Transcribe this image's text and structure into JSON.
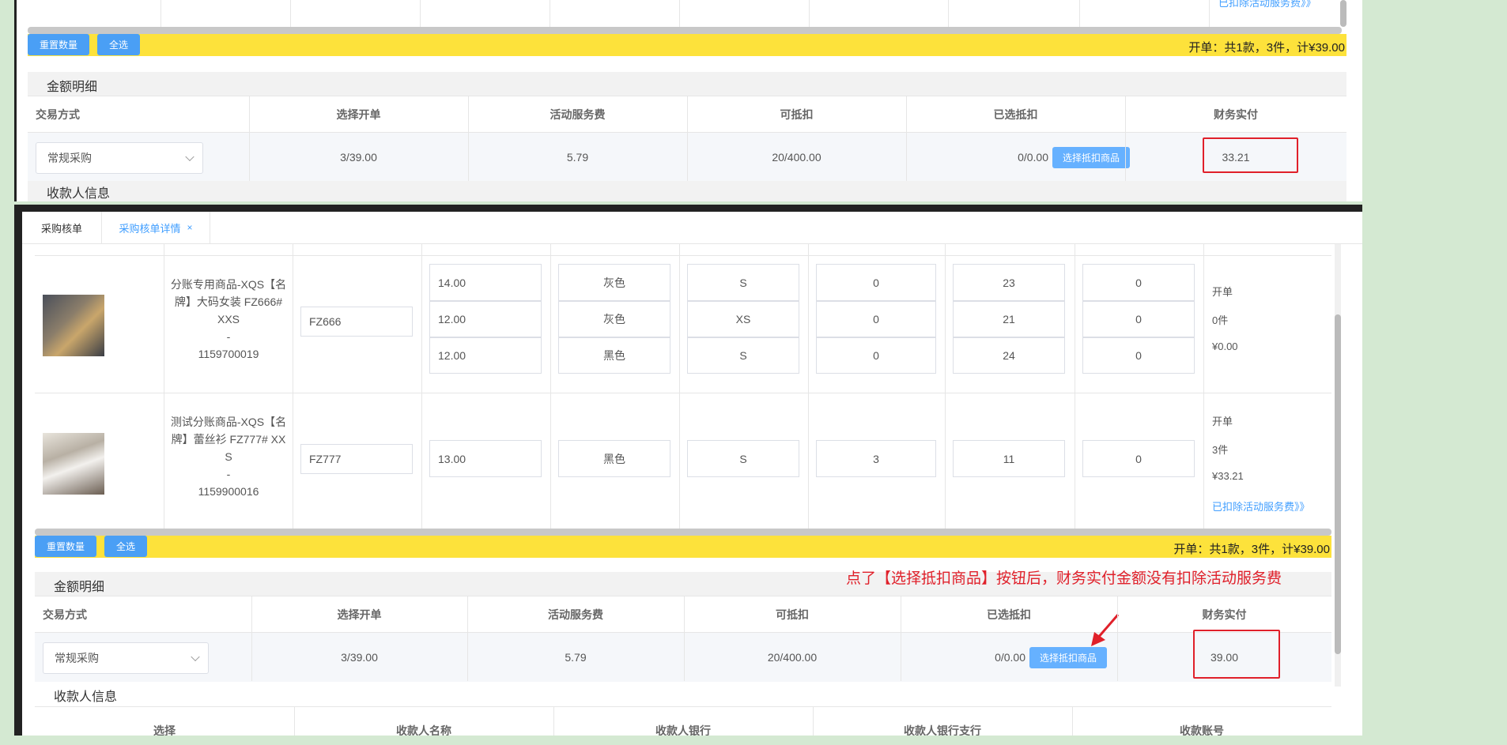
{
  "top": {
    "partial_link": "已扣除活动服务费》》",
    "reset_button": "重置数量",
    "select_all_button": "全选",
    "summary": "开单：共1款，3件，计¥39.00",
    "section_title": "金额明细",
    "headers": [
      "交易方式",
      "选择开单",
      "活动服务费",
      "可抵扣",
      "已选抵扣",
      "财务实付"
    ],
    "row": {
      "method": "常规采购",
      "order": "3/39.00",
      "fee": "5.79",
      "deductible": "20/400.00",
      "selected": "0/0.00",
      "deduct_button": "选择抵扣商品",
      "paid": "33.21"
    },
    "payee_section": "收款人信息"
  },
  "bottom": {
    "tabs": [
      {
        "label": "采购核单",
        "active": false
      },
      {
        "label": "采购核单详情",
        "active": true,
        "close": "×"
      }
    ],
    "products": [
      {
        "name_lines": [
          "分账专用商品-XQS【名",
          "牌】大码女装 FZ666#",
          "XXS",
          "-",
          "1159700019"
        ],
        "code": "FZ666",
        "skus": [
          {
            "price": "14.00",
            "color": "灰色",
            "size": "S",
            "qty": "0",
            "stock": "23",
            "extra": "0"
          },
          {
            "price": "12.00",
            "color": "灰色",
            "size": "XS",
            "qty": "0",
            "stock": "21",
            "extra": "0"
          },
          {
            "price": "12.00",
            "color": "黑色",
            "size": "S",
            "qty": "0",
            "stock": "24",
            "extra": "0"
          }
        ],
        "stat_label": "开单",
        "stat_count": "0件",
        "stat_amount": "¥0.00"
      },
      {
        "name_lines": [
          "测试分账商品-XQS【名",
          "牌】蕾丝衫 FZ777# XX",
          "S",
          "-",
          "1159900016"
        ],
        "code": "FZ777",
        "skus": [
          {
            "price": "13.00",
            "color": "黑色",
            "size": "S",
            "qty": "3",
            "stock": "11",
            "extra": "0"
          }
        ],
        "stat_label": "开单",
        "stat_count": "3件",
        "stat_amount": "¥33.21",
        "link": "已扣除活动服务费》》"
      }
    ],
    "reset_button": "重置数量",
    "select_all_button": "全选",
    "summary": "开单：共1款，3件，计¥39.00",
    "section_title": "金额明细",
    "annotation": "点了【选择抵扣商品】按钮后，财务实付金额没有扣除活动服务费",
    "headers": [
      "交易方式",
      "选择开单",
      "活动服务费",
      "可抵扣",
      "已选抵扣",
      "财务实付"
    ],
    "row": {
      "method": "常规采购",
      "order": "3/39.00",
      "fee": "5.79",
      "deductible": "20/400.00",
      "selected": "0/0.00",
      "deduct_button": "选择抵扣商品",
      "paid": "39.00"
    },
    "payee_section": "收款人信息",
    "payee_headers": [
      "选择",
      "收款人名称",
      "收款人银行",
      "收款人银行支行",
      "收款账号"
    ]
  },
  "colors": {
    "highlight_bar": "#fde23b",
    "button": "#4a9ff5",
    "annotation_red": "#e0202a",
    "page_bg": "#d4e9d2"
  }
}
